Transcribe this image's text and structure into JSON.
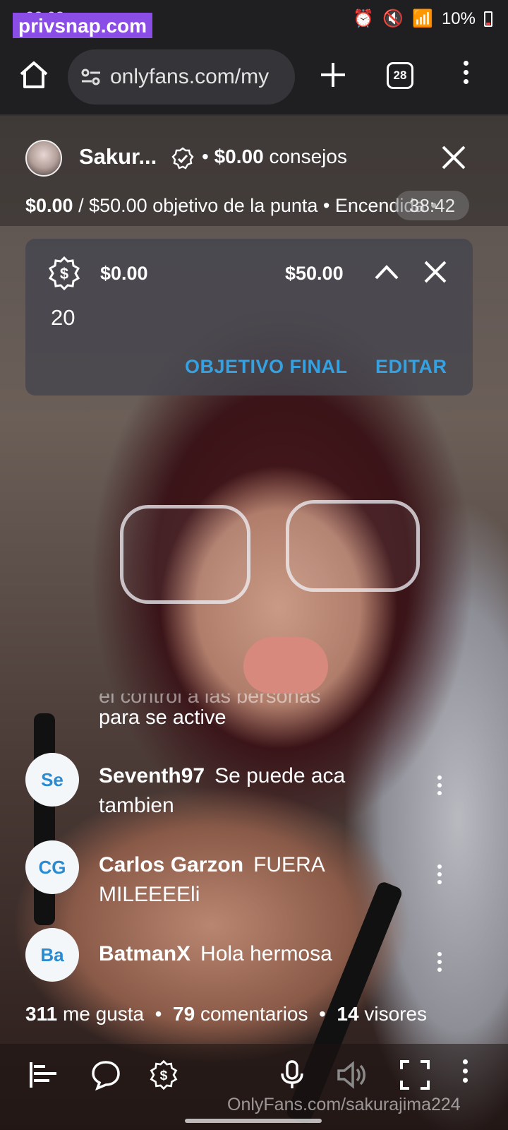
{
  "watermark_top": "privsnap.com",
  "status_bar": {
    "time": "22:08",
    "battery": "10%"
  },
  "browser": {
    "url": "onlyfans.com/my",
    "tab_count": "28"
  },
  "live": {
    "creator_name": "Sakur...",
    "tips_amount": "$0.00",
    "tips_label": "consejos",
    "goal_current": "$0.00",
    "goal_separator": " / ",
    "goal_target": "$50.00",
    "goal_label": "objetivo de la punta",
    "status": "Encendida",
    "timer": "38:42"
  },
  "goal_panel": {
    "tip_count": "20",
    "current": "$0.00",
    "target": "$50.00",
    "final_goal_label": "OBJETIVO FINAL",
    "edit_label": "EDITAR"
  },
  "chat": {
    "partial_top": "el control a las personas",
    "partial_text": "para se active",
    "comments": [
      {
        "initials": "Se",
        "user": "Seventh97",
        "line1": "Se puede aca",
        "line2": "tambien"
      },
      {
        "initials": "CG",
        "user": "Carlos Garzon",
        "line1": "FUERA",
        "line2": "MILEEEEli"
      },
      {
        "initials": "Ba",
        "user": "BatmanX",
        "line1": "Hola hermosa",
        "line2": ""
      }
    ]
  },
  "stats": {
    "likes": "311",
    "likes_label": "me gusta",
    "comments": "79",
    "comments_label": "comentarios",
    "viewers": "14",
    "viewers_label": "visores"
  },
  "watermark_bottom": "OnlyFans.com/sakurajima224",
  "colors": {
    "accent": "#35a1e0",
    "panel": "#46464e",
    "watermark": "#8a4de6"
  }
}
